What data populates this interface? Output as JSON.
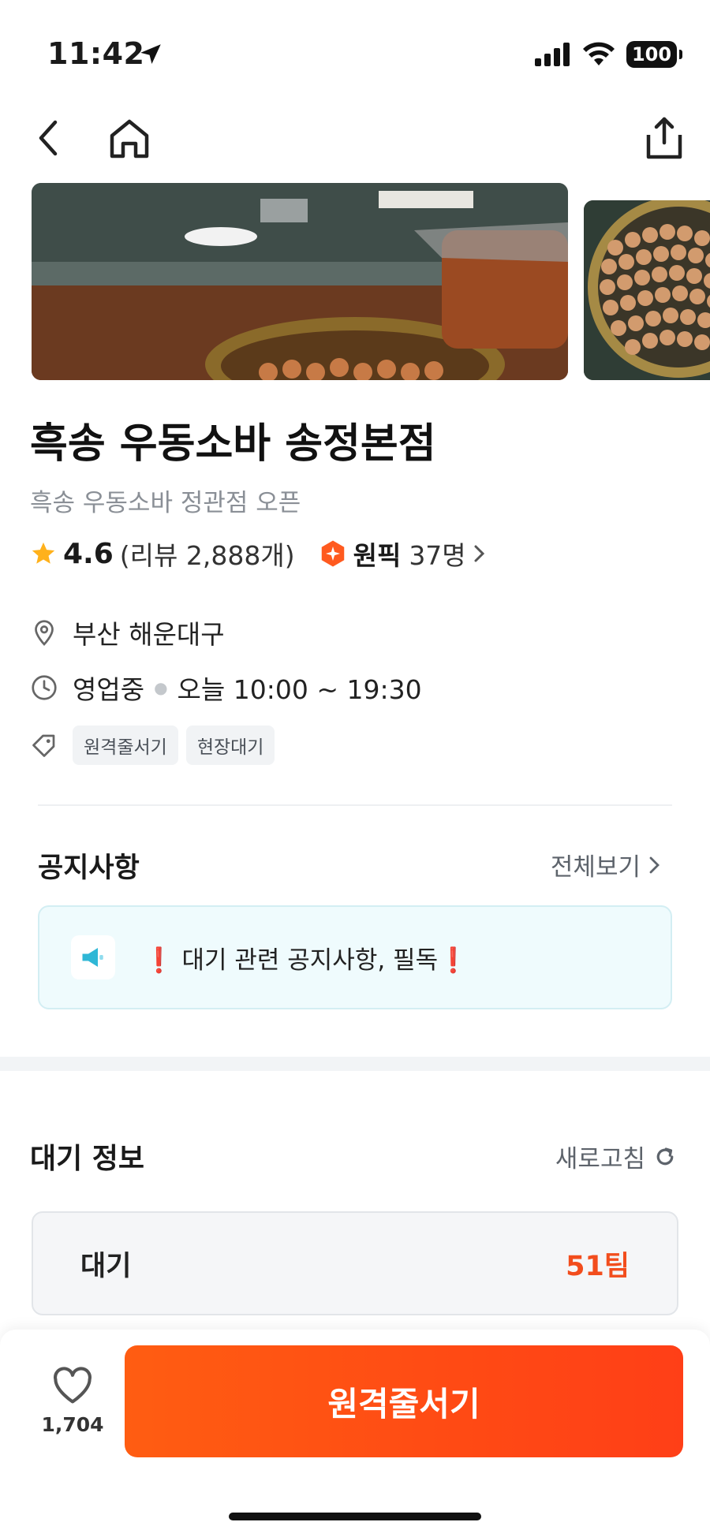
{
  "status": {
    "time": "11:42",
    "battery": "100"
  },
  "store": {
    "title": "흑송 우동소바 송정본점",
    "subtitle": "흑송 우동소바 정관점 오픈",
    "rating": "4.6",
    "review_text": "(리뷰 2,888개)",
    "pick_label": "원픽",
    "pick_count": "37명"
  },
  "info": {
    "location": "부산 해운대구",
    "status": "영업중",
    "hours": "오늘 10:00 ~ 19:30",
    "tags": [
      "원격줄서기",
      "현장대기"
    ]
  },
  "notice": {
    "title": "공지사항",
    "more": "전체보기",
    "excl_left": "❗",
    "text": "대기 관련 공지사항, 필독",
    "excl_right": "❗"
  },
  "wait": {
    "title": "대기 정보",
    "refresh": "새로고침",
    "label": "대기",
    "count": "51팀"
  },
  "bottom": {
    "favorites": "1,704",
    "cta": "원격줄서기"
  },
  "colors": {
    "accent": "#ff5212",
    "notice_bg": "#effbfd",
    "star": "#ffb11b"
  }
}
